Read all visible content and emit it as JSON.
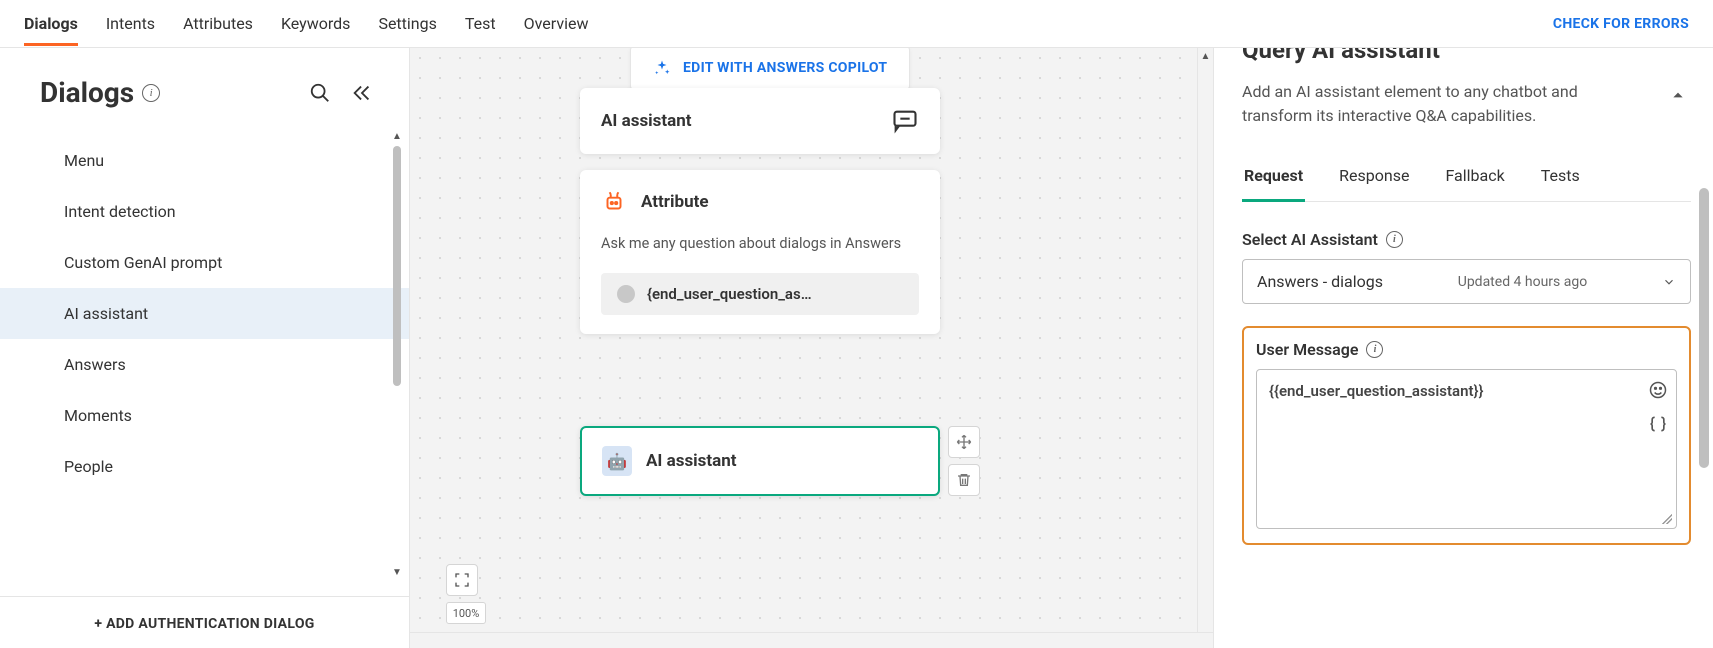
{
  "topnav": {
    "tabs": [
      "Dialogs",
      "Intents",
      "Attributes",
      "Keywords",
      "Settings",
      "Test",
      "Overview"
    ],
    "active_index": 0,
    "check_errors": "CHECK FOR ERRORS"
  },
  "sidebar": {
    "title": "Dialogs",
    "items": [
      "Menu",
      "Intent detection",
      "Custom GenAI prompt",
      "AI assistant",
      "Answers",
      "Moments",
      "People"
    ],
    "active_index": 3,
    "footer_action": "+ ADD AUTHENTICATION DIALOG"
  },
  "canvas": {
    "copilot_label": "EDIT WITH ANSWERS COPILOT",
    "node_ai_top": {
      "title": "AI assistant"
    },
    "node_attr": {
      "title": "Attribute",
      "desc": "Ask me any question about dialogs in Answers",
      "chip": "{end_user_question_as…"
    },
    "node_ai_sel": {
      "title": "AI assistant"
    },
    "zoom": "100%"
  },
  "rightpanel": {
    "title_cut": "Query AI assistant",
    "desc": "Add an AI assistant element to any chatbot and transform its interactive Q&A capabilities.",
    "tabs": [
      "Request",
      "Response",
      "Fallback",
      "Tests"
    ],
    "active_tab": 0,
    "select_label": "Select AI Assistant",
    "select_value": "Answers - dialogs",
    "select_meta": "Updated 4 hours ago",
    "user_msg_label": "User Message",
    "user_msg_value": "{{end_user_question_assistant}}"
  }
}
